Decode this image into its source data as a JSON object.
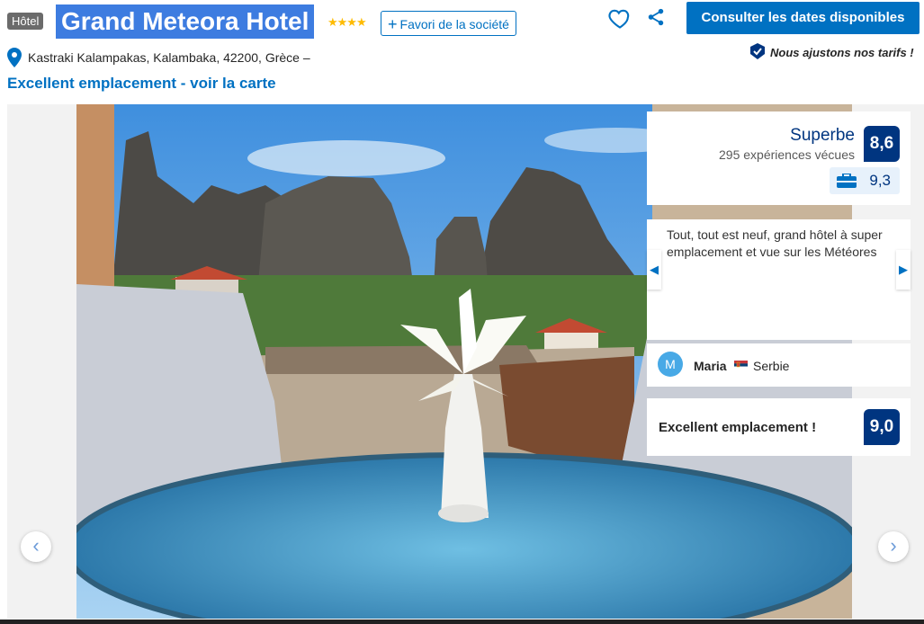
{
  "header": {
    "type_badge": "Hôtel",
    "title": "Grand Meteora Hotel",
    "stars": "★★★★",
    "favorite_label": "Favori de la société",
    "cta_label": "Consulter les dates disponibles",
    "price_note": "Nous ajustons nos tarifs !"
  },
  "location": {
    "address": "Kastraki Kalampakas, Kalambaka, 42200, Grèce –",
    "link": "Excellent emplacement - voir la carte"
  },
  "score": {
    "word": "Superbe",
    "count": "295 expériences vécues",
    "value": "8,6",
    "business_value": "9,3"
  },
  "review": {
    "text": "Tout, tout est neuf, grand hôtel à super emplacement et vue sur les Météores",
    "initial": "M",
    "name": "Maria",
    "country": "Serbie"
  },
  "location_score": {
    "label": "Excellent emplacement !",
    "value": "9,0"
  },
  "nav": {
    "prev": "‹",
    "next": "›"
  },
  "colors": {
    "brand": "#0071c2",
    "dark": "#003580",
    "star": "#febb02"
  }
}
